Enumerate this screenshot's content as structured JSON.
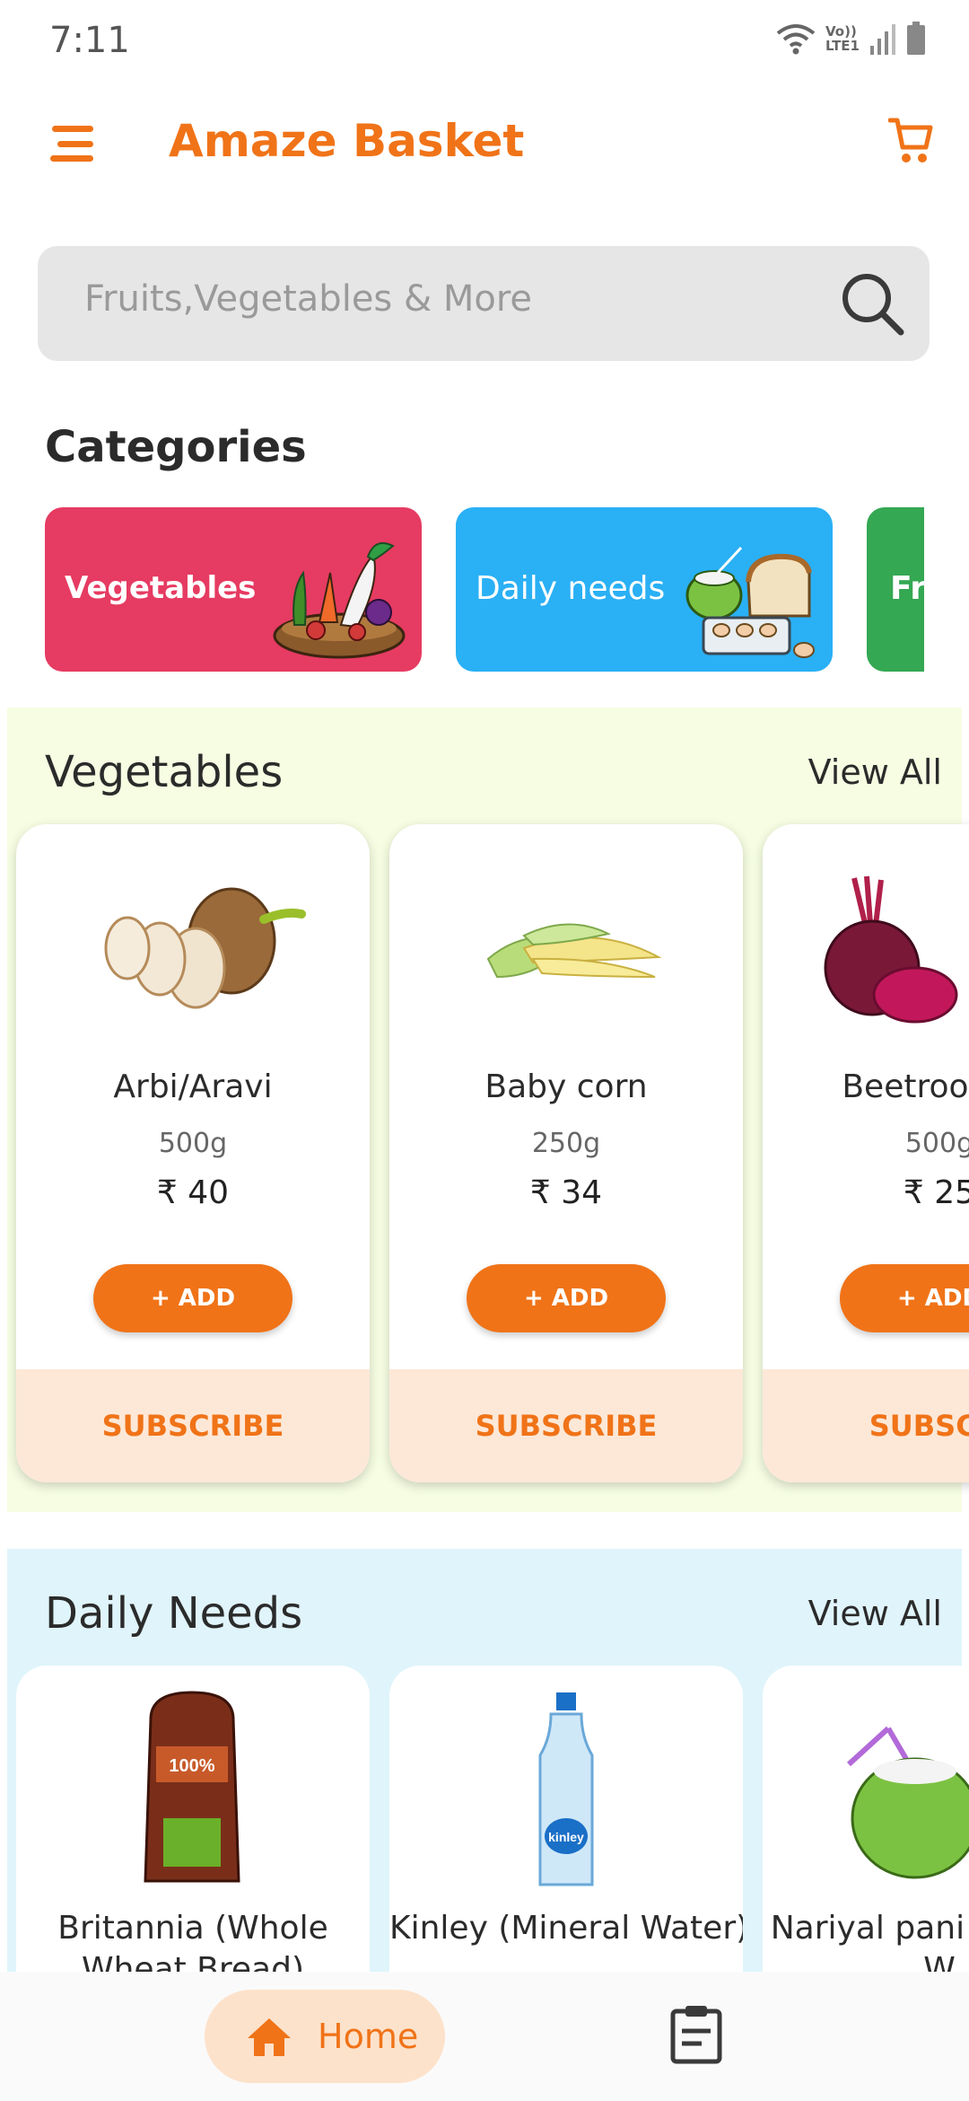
{
  "status_bar": {
    "time": "7:11",
    "network_label": "Vo)) LTE1",
    "icons": [
      "wifi-icon",
      "volte-icon",
      "signal-icon",
      "battery-icon"
    ]
  },
  "app_bar": {
    "title": "Amaze Basket",
    "menu_icon": "menu-icon",
    "cart_icon": "cart-icon"
  },
  "search": {
    "placeholder": "Fruits,Vegetables & More",
    "icon": "search-icon"
  },
  "categories": {
    "heading": "Categories",
    "items": [
      {
        "label": "Vegetables",
        "color": "#e63b62"
      },
      {
        "label": "Daily needs",
        "color": "#2ab0f5"
      },
      {
        "label": "Fr",
        "color": "#34a853"
      }
    ]
  },
  "vegetables": {
    "heading": "Vegetables",
    "view_all": "View All",
    "products": [
      {
        "name": "Arbi/Aravi",
        "qty": "500g",
        "price": "₹ 40",
        "add": "+ ADD",
        "subscribe": "SUBSCRIBE"
      },
      {
        "name": "Baby corn",
        "qty": "250g",
        "price": "₹ 34",
        "add": "+ ADD",
        "subscribe": "SUBSCRIBE"
      },
      {
        "name": "Beetroot(Ch",
        "qty": "500g",
        "price": "₹ 25",
        "add": "+ ADD",
        "subscribe": "SUBSCRI"
      }
    ]
  },
  "daily_needs": {
    "heading": "Daily Needs",
    "view_all": "View All",
    "products": [
      {
        "name": "Britannia (Whole Wheat Bread)"
      },
      {
        "name": "Kinley (Mineral Water)"
      },
      {
        "name": "Nariyal pani Coconut W"
      }
    ]
  },
  "bottom_nav": {
    "home_label": "Home",
    "home_icon": "home-icon",
    "orders_icon": "orders-icon"
  },
  "colors": {
    "accent": "#f07318",
    "veg_bg": "#f6fde2",
    "daily_bg": "#e0f4fb",
    "subscribe_bg": "#fde8d7"
  }
}
